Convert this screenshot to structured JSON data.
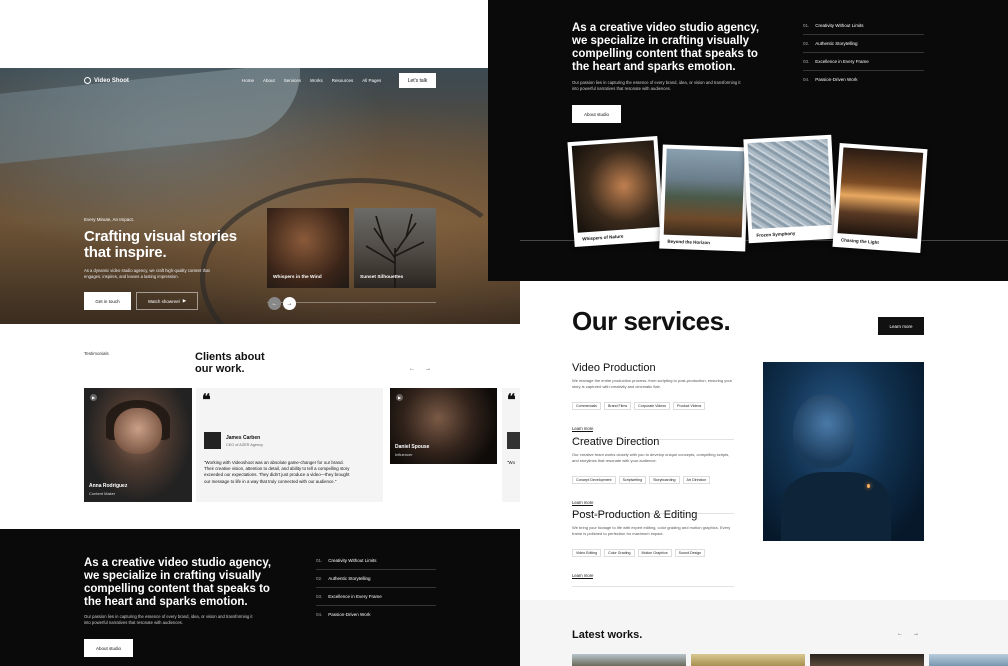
{
  "hero": {
    "brand": "Video Shoot",
    "nav": [
      "Home",
      "About",
      "Services",
      "Works",
      "Resources",
      "All Pages"
    ],
    "cta": "Let's talk",
    "eyebrow": "Every Minute, An Impact.",
    "title": "Crafting visual stories that inspire.",
    "description": "As a dynamic video studio agency, we craft high-quality content that engages, inspires, and leaves a lasting impression.",
    "primary_btn": "Get in touch",
    "secondary_btn": "Watch showreel",
    "slides": [
      "Whispers in the Wind",
      "Sunset Silhouettes"
    ]
  },
  "testimonials": {
    "label": "Testimonials",
    "heading": "Clients about our work.",
    "cards": [
      {
        "name": "Anna Rodriguez",
        "role": "Content Maker"
      },
      {
        "name": "Daniel Spouse",
        "role": "Influencer"
      }
    ],
    "quote": {
      "name": "James Carben",
      "role": "CEO of AZER Agency",
      "text": "\"Working with Videoshoot was an absolute game-changer for our brand. Their creative vision, attention to detail, and ability to tell a compelling story exceeded our expectations. They didn't just produce a video—they brought our message to life in a way that truly connected with our audience.\"",
      "next_text": "\"Wo"
    }
  },
  "agency": {
    "title": "As a creative video studio agency, we specialize in crafting visually compelling content that speaks to the heart and sparks emotion.",
    "paragraph": "Our passion lies in capturing the essence of every brand, idea, or vision and transforming it into powerful narratives that resonate with audiences.",
    "button": "About studio",
    "list": [
      {
        "num": "01.",
        "text": "Creativity Without Limits"
      },
      {
        "num": "02.",
        "text": "Authentic Storytelling"
      },
      {
        "num": "03.",
        "text": "Excellence in Every Frame"
      },
      {
        "num": "04.",
        "text": "Passion-Driven Work"
      }
    ]
  },
  "polaroids": [
    "Whispers of Nature",
    "Beyond the Horizon",
    "Frozen Symphony",
    "Chasing the Light"
  ],
  "services": {
    "heading": "Our services.",
    "button": "Learn more",
    "items": [
      {
        "title": "Video Production",
        "desc": "We manage the entire production process, from scripting to post-production, ensuring your story is captured with creativity and cinematic flair.",
        "tags": [
          "Commercials",
          "Brand Films",
          "Corporate Videos",
          "Product Videos"
        ],
        "link": "Learn more"
      },
      {
        "title": "Creative Direction",
        "desc": "Our creative team works closely with you to develop unique concepts, compelling scripts, and storylines that resonate with your audience.",
        "tags": [
          "Concept Development",
          "Scriptwriting",
          "Storyboarding",
          "Art Direction"
        ],
        "link": "Learn more"
      },
      {
        "title": "Post-Production & Editing",
        "desc": "We bring your footage to life with expert editing, color grading and motion graphics. Every frame is polished to perfection for maximum impact.",
        "tags": [
          "Video Editing",
          "Color Grading",
          "Motion Graphics",
          "Sound Design"
        ],
        "link": "Learn more"
      }
    ]
  },
  "works": {
    "heading": "Latest works."
  },
  "icons": {
    "prev": "←",
    "next": "→",
    "quote": "❝",
    "play": "▶"
  }
}
